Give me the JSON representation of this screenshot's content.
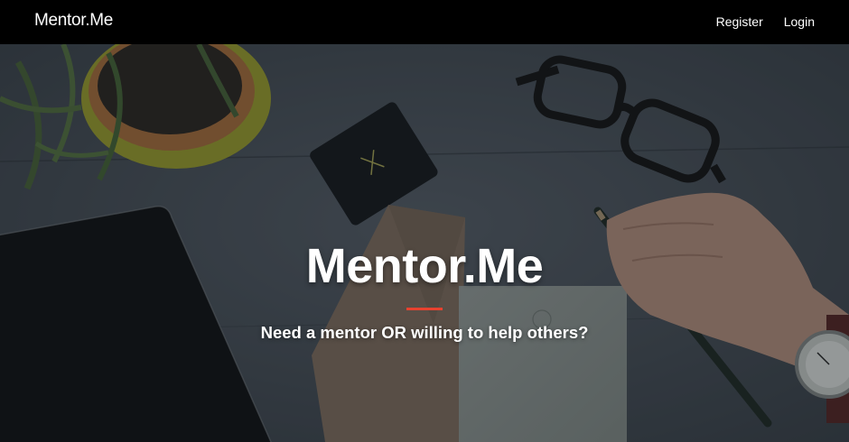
{
  "navbar": {
    "brand": "Mentor.Me",
    "links": [
      {
        "label": "Register"
      },
      {
        "label": "Login"
      }
    ]
  },
  "hero": {
    "title": "Mentor.Me",
    "subtitle": "Need a mentor OR willing to help others?",
    "divider_color": "#e8422f"
  },
  "colors": {
    "navbar_bg": "#000000",
    "text": "#ffffff",
    "accent": "#e8422f",
    "desk": "#4d5660"
  },
  "icons": [
    "plant-pot-image",
    "notebook-image",
    "eyeglasses-image",
    "tablet-image",
    "envelope-image",
    "hand-with-pencil-image",
    "wristwatch-image"
  ]
}
